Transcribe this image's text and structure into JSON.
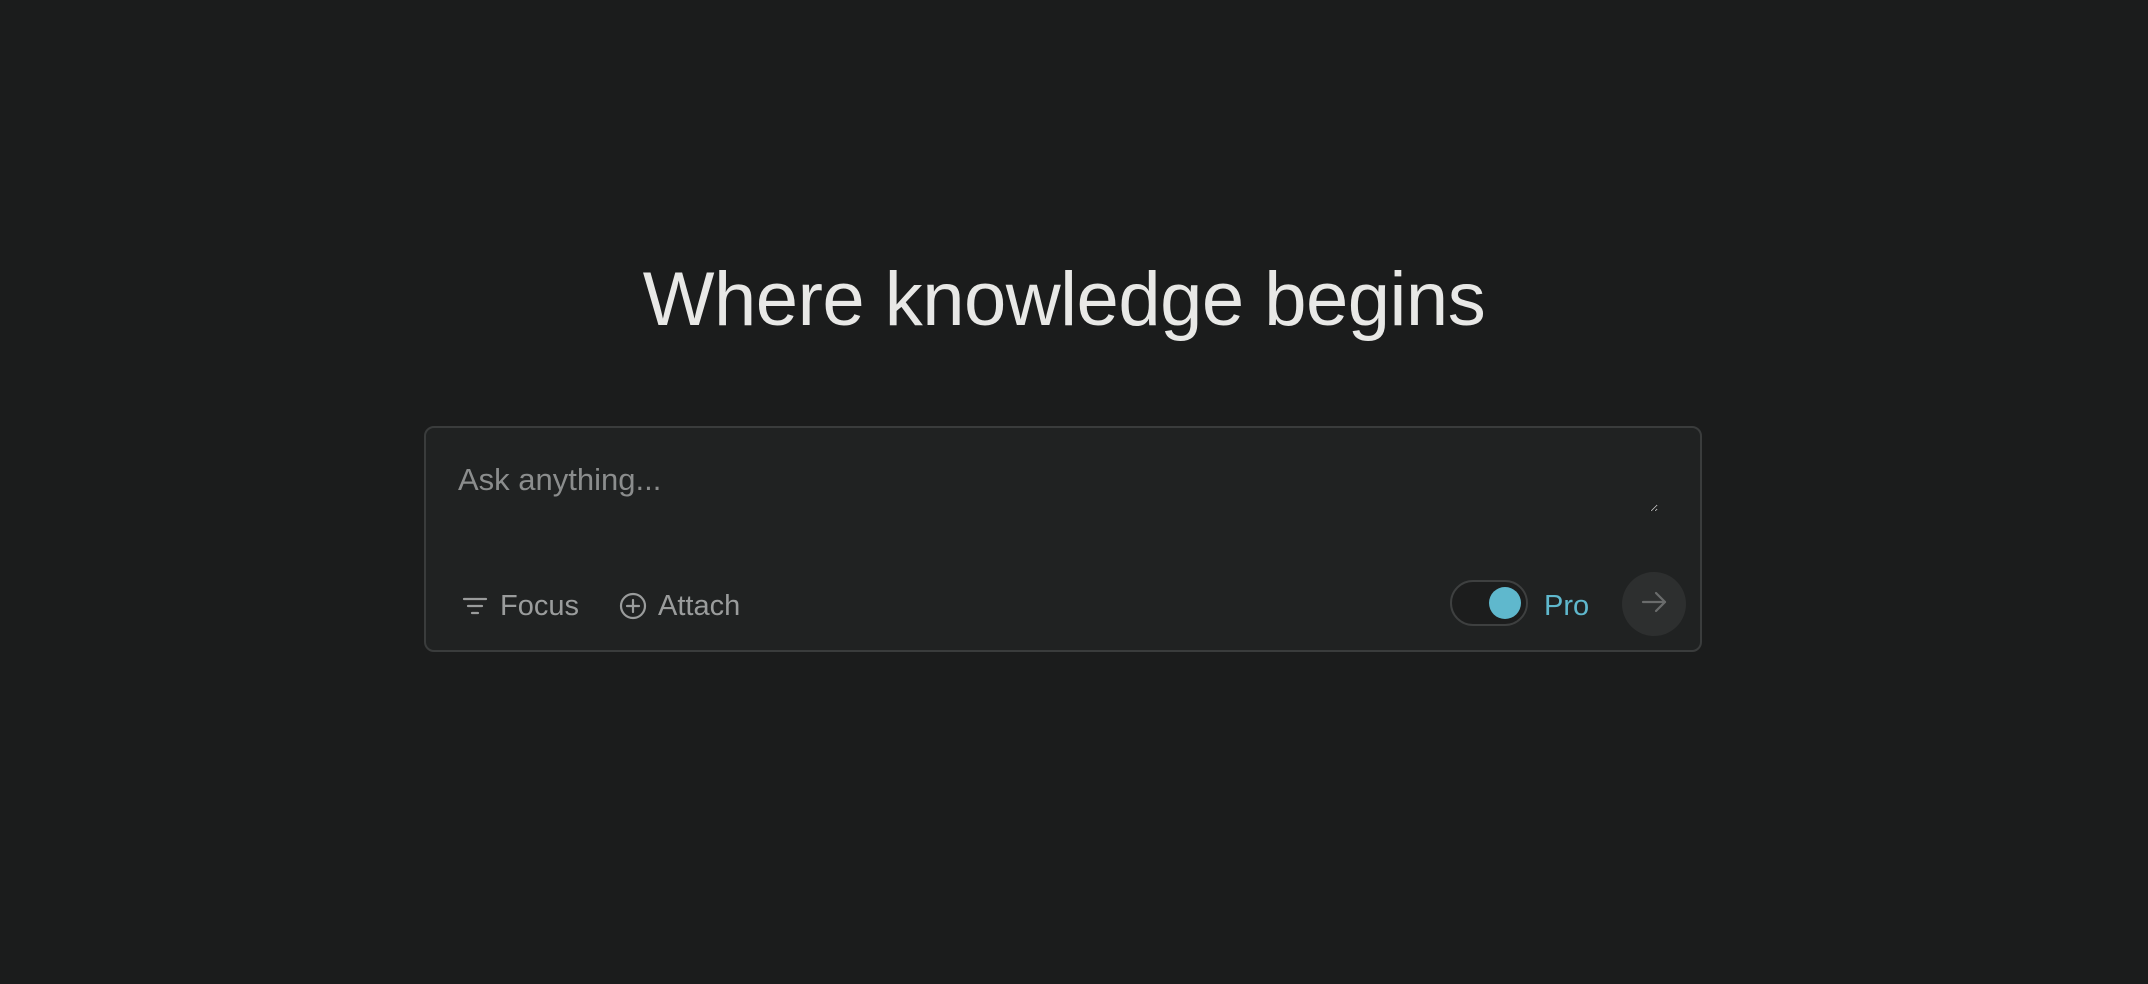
{
  "hero": {
    "title": "Where knowledge begins"
  },
  "search": {
    "placeholder": "Ask anything...",
    "value": ""
  },
  "toolbar": {
    "focus_label": "Focus",
    "focus_icon": "filter-lines-icon",
    "attach_label": "Attach",
    "attach_icon": "plus-circle-icon",
    "pro_label": "Pro",
    "pro_enabled": true,
    "submit_icon": "arrow-right-icon"
  },
  "colors": {
    "background": "#1b1c1c",
    "card": "#202222",
    "accent": "#5fb8cd",
    "text_primary": "#e8e8e6",
    "text_muted": "#9a9c9c"
  }
}
